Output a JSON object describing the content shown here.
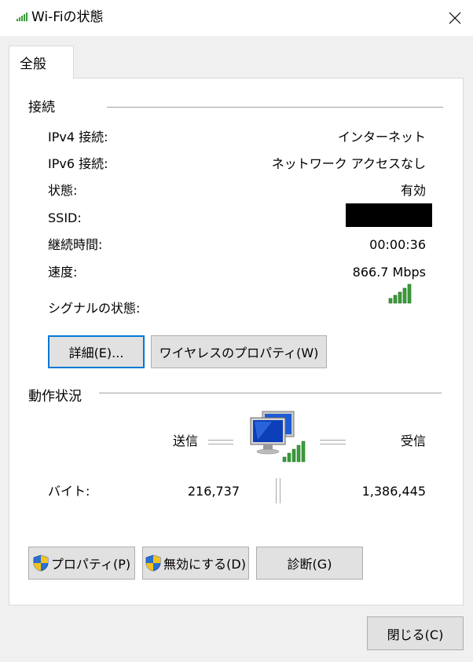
{
  "window": {
    "title": "Wi-Fiの状態",
    "close_glyph": "✕"
  },
  "tabs": [
    {
      "label": "全般"
    }
  ],
  "connection": {
    "group_label": "接続",
    "rows": [
      {
        "label": "IPv4 接続:",
        "value": "インターネット"
      },
      {
        "label": "IPv6 接続:",
        "value": "ネットワーク アクセスなし"
      },
      {
        "label": "状態:",
        "value": "有効"
      },
      {
        "label": "SSID:",
        "value": ""
      },
      {
        "label": "継続時間:",
        "value": "00:00:36"
      },
      {
        "label": "速度:",
        "value": "866.7 Mbps"
      }
    ],
    "signal_label": "シグナルの状態:",
    "signal_bars": 5,
    "signal_bars_filled": 5,
    "details_button": "詳細(E)...",
    "wireless_props_button": "ワイヤレスのプロパティ(W)"
  },
  "activity": {
    "group_label": "動作状況",
    "sent_label": "送信",
    "received_label": "受信",
    "bytes_label": "バイト:",
    "bytes_sent": "216,737",
    "bytes_received": "1,386,445"
  },
  "actions": {
    "properties_button": "プロパティ(P)",
    "disable_button": "無効にする(D)",
    "diagnose_button": "診断(G)"
  },
  "footer": {
    "close_button": "閉じる(C)"
  },
  "colors": {
    "accent": "#0078d7",
    "signal_green": "#3a9d3a",
    "ssid_mask": "#000000"
  }
}
